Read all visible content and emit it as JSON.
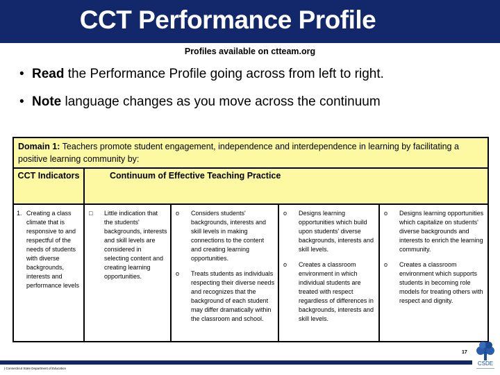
{
  "header": {
    "title": "CCT Performance Profile",
    "subtitle": "Profiles available on ctteam.org",
    "band_color": "#13286a"
  },
  "bullets": [
    {
      "bold": "Read",
      "rest": " the Performance Profile going across from left to right."
    },
    {
      "bold": "Note",
      "rest": " language changes as you move across the continuum"
    }
  ],
  "table": {
    "domain_label": "Domain 1:",
    "domain_text": " Teachers promote student engagement, independence and interdependence in learning by facilitating a positive learning community by:",
    "indicators_header": "CCT Indicators",
    "continuum_header": "Continuum of Effective Teaching Practice",
    "header_bg": "#fdf9a3",
    "indicator": {
      "number": "1.",
      "text": "Creating a class climate that is responsive to and respectful of the needs of students with diverse backgrounds, interests and performance levels"
    },
    "columns": [
      {
        "marker": "□",
        "items": [
          "Little indication that the students' backgrounds, interests and skill levels are considered in selecting content and creating learning opportunities."
        ]
      },
      {
        "marker": "o",
        "items": [
          "Considers students' backgrounds, interests and skill levels in making connections to the content and creating learning opportunities.",
          "Treats students as individuals respecting their diverse needs and recognizes that the background of each student may differ dramatically within the classroom and school."
        ]
      },
      {
        "marker": "o",
        "items": [
          "Designs learning opportunities which build upon students' diverse backgrounds, interests and skill levels.",
          "Creates a classroom environment in which individual students are treated with respect regardless of differences in backgrounds, interests and skill levels."
        ]
      },
      {
        "marker": "o",
        "items": [
          "Designs learning opportunities which capitalize on students' diverse backgrounds and interests to enrich the learning community.",
          "Creates a classroom environment which supports students in becoming role models for treating others with respect and dignity."
        ]
      }
    ]
  },
  "footer": {
    "org_text": "| Connecticut State Department of Education",
    "page_number": "17",
    "logo_text": "CSDE"
  }
}
